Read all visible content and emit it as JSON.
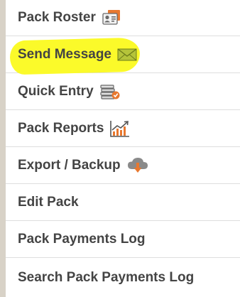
{
  "menu": {
    "items": [
      {
        "label": "Pack Roster",
        "icon": "roster-card-icon"
      },
      {
        "label": "Send Message",
        "icon": "envelope-icon",
        "highlighted": true
      },
      {
        "label": "Quick Entry",
        "icon": "stacked-books-icon"
      },
      {
        "label": "Pack Reports",
        "icon": "chart-report-icon"
      },
      {
        "label": "Export / Backup",
        "icon": "cloud-download-icon"
      },
      {
        "label": "Edit Pack",
        "icon": ""
      },
      {
        "label": "Pack Payments Log",
        "icon": ""
      },
      {
        "label": "Search Pack Payments Log",
        "icon": ""
      }
    ]
  },
  "colors": {
    "text": "#444444",
    "highlight": "#fbfa2a",
    "divider": "#dedede",
    "left_rule": "#d8d2c7"
  }
}
